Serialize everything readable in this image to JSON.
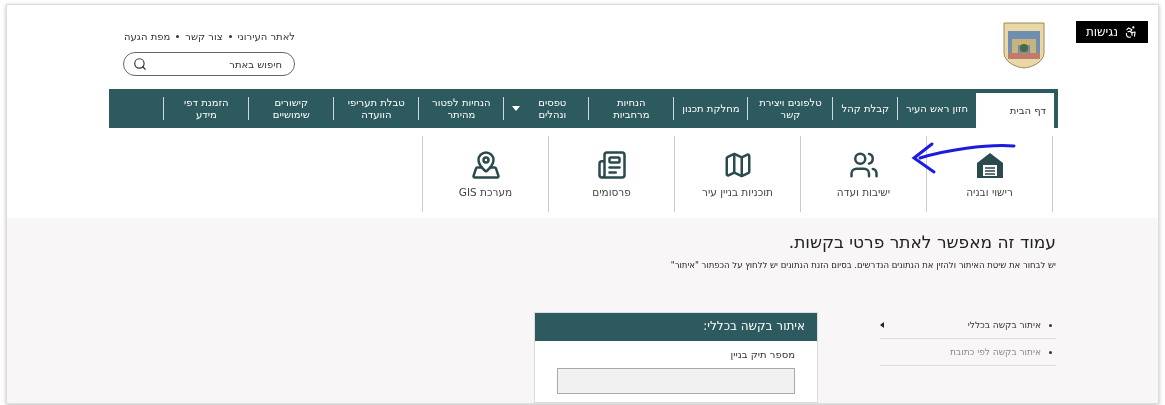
{
  "accessibility_button": {
    "label": "נגישות"
  },
  "top_links": [
    "לאתר העירוני",
    "צור קשר",
    "מפת הגעה"
  ],
  "search": {
    "placeholder": "חיפוש באתר"
  },
  "nav": {
    "items": [
      {
        "label": "דף הבית",
        "selected": true,
        "has_dropdown": false
      },
      {
        "label": "חזון ראש העיר",
        "selected": false,
        "has_dropdown": false
      },
      {
        "label": "קבלת קהל",
        "selected": false,
        "has_dropdown": false
      },
      {
        "label": "טלפונים ויצירת קשר",
        "selected": false,
        "has_dropdown": false
      },
      {
        "label": "מחלקת תכנון",
        "selected": false,
        "has_dropdown": false
      },
      {
        "label": "הנחיות מרחביות",
        "selected": false,
        "has_dropdown": false
      },
      {
        "label": "טפסים ונהלים",
        "selected": false,
        "has_dropdown": true
      },
      {
        "label": "הנחיות לפטור מהיתר",
        "selected": false,
        "has_dropdown": false
      },
      {
        "label": "טבלת תעריפי הוועדה",
        "selected": false,
        "has_dropdown": false
      },
      {
        "label": "קישורים שימושיים",
        "selected": false,
        "has_dropdown": false
      },
      {
        "label": "הזמנת דפי מידע",
        "selected": false,
        "has_dropdown": false
      }
    ]
  },
  "quick_links": [
    {
      "label": "רישוי ובניה",
      "kind": "house"
    },
    {
      "label": "ישיבות ועדה",
      "kind": "meeting"
    },
    {
      "label": "תוכניות בניין עיר",
      "kind": "map"
    },
    {
      "label": "פרסומים",
      "kind": "newspaper"
    },
    {
      "label": "מערכת GIS",
      "kind": "pin"
    }
  ],
  "page_title": "עמוד זה מאפשר לאתר פרטי בקשות.",
  "instructions": "יש לבחור את שיטת האיתור ולהזין את הנתונים הנדרשים. בסיום הזנת הנתונים יש ללחוץ על הכפתור \"איתור\"",
  "side_menu": {
    "items": [
      {
        "label": "איתור בקשה בכללי",
        "selected": true
      },
      {
        "label": "איתור בקשה לפי כתובת",
        "selected": false
      }
    ]
  },
  "search_panel": {
    "title": "איתור בקשה בכללי:",
    "field_label": "מספר תיק בניין"
  }
}
